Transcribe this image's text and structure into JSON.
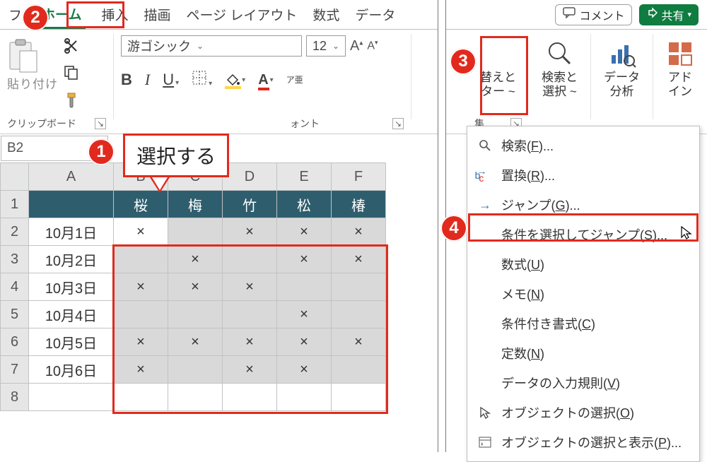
{
  "tabs": {
    "file": "フ",
    "home": "ホーム",
    "insert": "挿入",
    "draw": "描画",
    "layout": "ページ レイアウト",
    "formula": "数式",
    "data": "データ"
  },
  "topright": {
    "comment": "コメント",
    "share": "共有"
  },
  "ribbon": {
    "paste": "貼り付け",
    "clipboard": "クリップボード",
    "font_name": "游ゴシック",
    "font_size": "12",
    "font_label": "ォント",
    "bold": "B",
    "italic": "I",
    "under": "U",
    "ruby": "ア亜",
    "sort": "替えと",
    "sort2": "ター ~",
    "find": "検索と",
    "find2": "選択 ~",
    "analysis": "データ",
    "analysis2": "分析",
    "addin": "アド",
    "addin2": "イン",
    "edit_label": "集"
  },
  "namebox": "B2",
  "callout": "選択する",
  "columns": [
    "A",
    "B",
    "C",
    "D",
    "E",
    "F"
  ],
  "headers": [
    "",
    "桜",
    "梅",
    "竹",
    "松",
    "椿"
  ],
  "rows": [
    {
      "n": "2",
      "date": "10月1日",
      "c": [
        "×",
        "",
        "×",
        "×",
        "×"
      ]
    },
    {
      "n": "3",
      "date": "10月2日",
      "c": [
        "",
        "×",
        "",
        "×",
        "×"
      ]
    },
    {
      "n": "4",
      "date": "10月3日",
      "c": [
        "×",
        "×",
        "×",
        "",
        ""
      ]
    },
    {
      "n": "5",
      "date": "10月4日",
      "c": [
        "",
        "",
        "",
        "×",
        ""
      ]
    },
    {
      "n": "6",
      "date": "10月5日",
      "c": [
        "×",
        "×",
        "×",
        "×",
        "×"
      ]
    },
    {
      "n": "7",
      "date": "10月6日",
      "c": [
        "×",
        "",
        "×",
        "×",
        ""
      ]
    }
  ],
  "row8": "8",
  "menu": {
    "find": "検索(",
    "find_k": "F",
    "find_e": ")...",
    "replace": "置換(",
    "replace_k": "R",
    "replace_e": ")...",
    "jump": "ジャンプ(",
    "jump_k": "G",
    "jump_e": ")...",
    "special": "条件を選択してジャンプ(",
    "special_k": "S",
    "special_e": ")...",
    "formulas": "数式(",
    "formulas_k": "U",
    "formulas_e": ")",
    "notes": "メモ(",
    "notes_k": "N",
    "notes_e": ")",
    "condfmt": "条件付き書式(",
    "condfmt_k": "C",
    "condfmt_e": ")",
    "const": "定数(",
    "const_k": "N",
    "const_e": ")",
    "dv": "データの入力規則(",
    "dv_k": "V",
    "dv_e": ")",
    "obj": "オブジェクトの選択(",
    "obj_k": "O",
    "obj_e": ")",
    "selpane": "オブジェクトの選択と表示(",
    "selpane_k": "P",
    "selpane_e": ")..."
  },
  "badges": {
    "b1": "1",
    "b2": "2",
    "b3": "3",
    "b4": "4"
  }
}
